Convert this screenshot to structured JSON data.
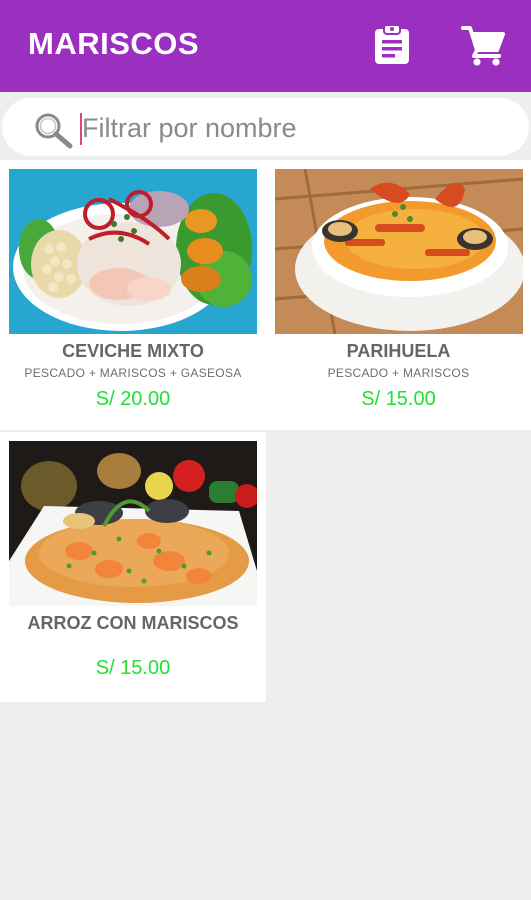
{
  "appbar": {
    "title": "MARISCOS",
    "orders_icon": "clipboard-icon",
    "cart_icon": "shopping-cart-icon",
    "color": "#9b2fc0"
  },
  "search": {
    "placeholder": "Filtrar por nombre",
    "value": "",
    "icon": "search-icon"
  },
  "products": [
    {
      "name": "CEVICHE MIXTO",
      "description": "PESCADO + MARISCOS + GASEOSA",
      "price": "S/ 20.00"
    },
    {
      "name": "PARIHUELA",
      "description": "PESCADO + MARISCOS",
      "price": "S/ 15.00"
    },
    {
      "name": "ARROZ CON MARISCOS",
      "description": "",
      "price": "S/ 15.00"
    }
  ],
  "colors": {
    "price": "#22e033",
    "background": "#eeeeee"
  }
}
